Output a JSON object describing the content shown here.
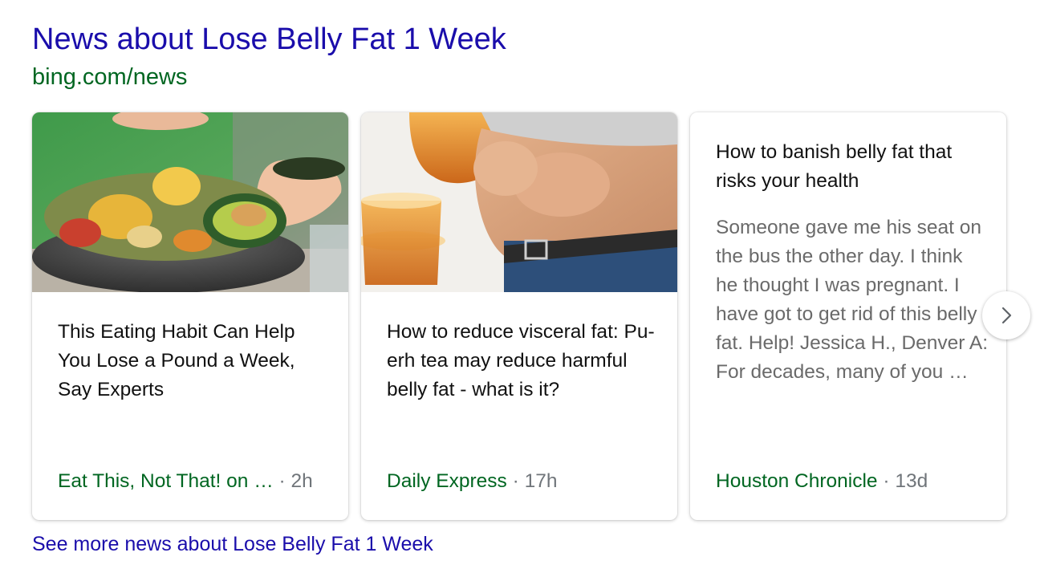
{
  "header": {
    "title": "News about Lose Belly Fat 1 Week",
    "source": "bing.com/news"
  },
  "cards": [
    {
      "headline": "This Eating Habit Can Help You Lose a Pound a Week, Say Experts",
      "publisher": "Eat This, Not That! on …",
      "separator": "·",
      "age": "2h",
      "image": "salad-bowl-with-seeds"
    },
    {
      "headline": "How to reduce visceral fat: Pu-erh tea may reduce harmful belly fat - what is it?",
      "publisher": "Daily Express",
      "separator": "·",
      "age": "17h",
      "image": "belly-with-tea"
    },
    {
      "headline": "How to banish belly fat that risks your health",
      "snippet": "Someone gave me his seat on the bus the other day. I think he thought I was pregnant. I have got to get rid of this belly fat. Help! Jessica H., Denver A: For decades, many of you …",
      "publisher": "Houston Chronicle",
      "separator": "·",
      "age": "13d"
    }
  ],
  "navigation": {
    "next_icon": "chevron-right-icon"
  },
  "footer": {
    "see_more": "See more news about Lose Belly Fat 1 Week"
  },
  "colors": {
    "link": "#1a0dab",
    "source_green": "#006621",
    "meta_gray": "#70757a"
  }
}
